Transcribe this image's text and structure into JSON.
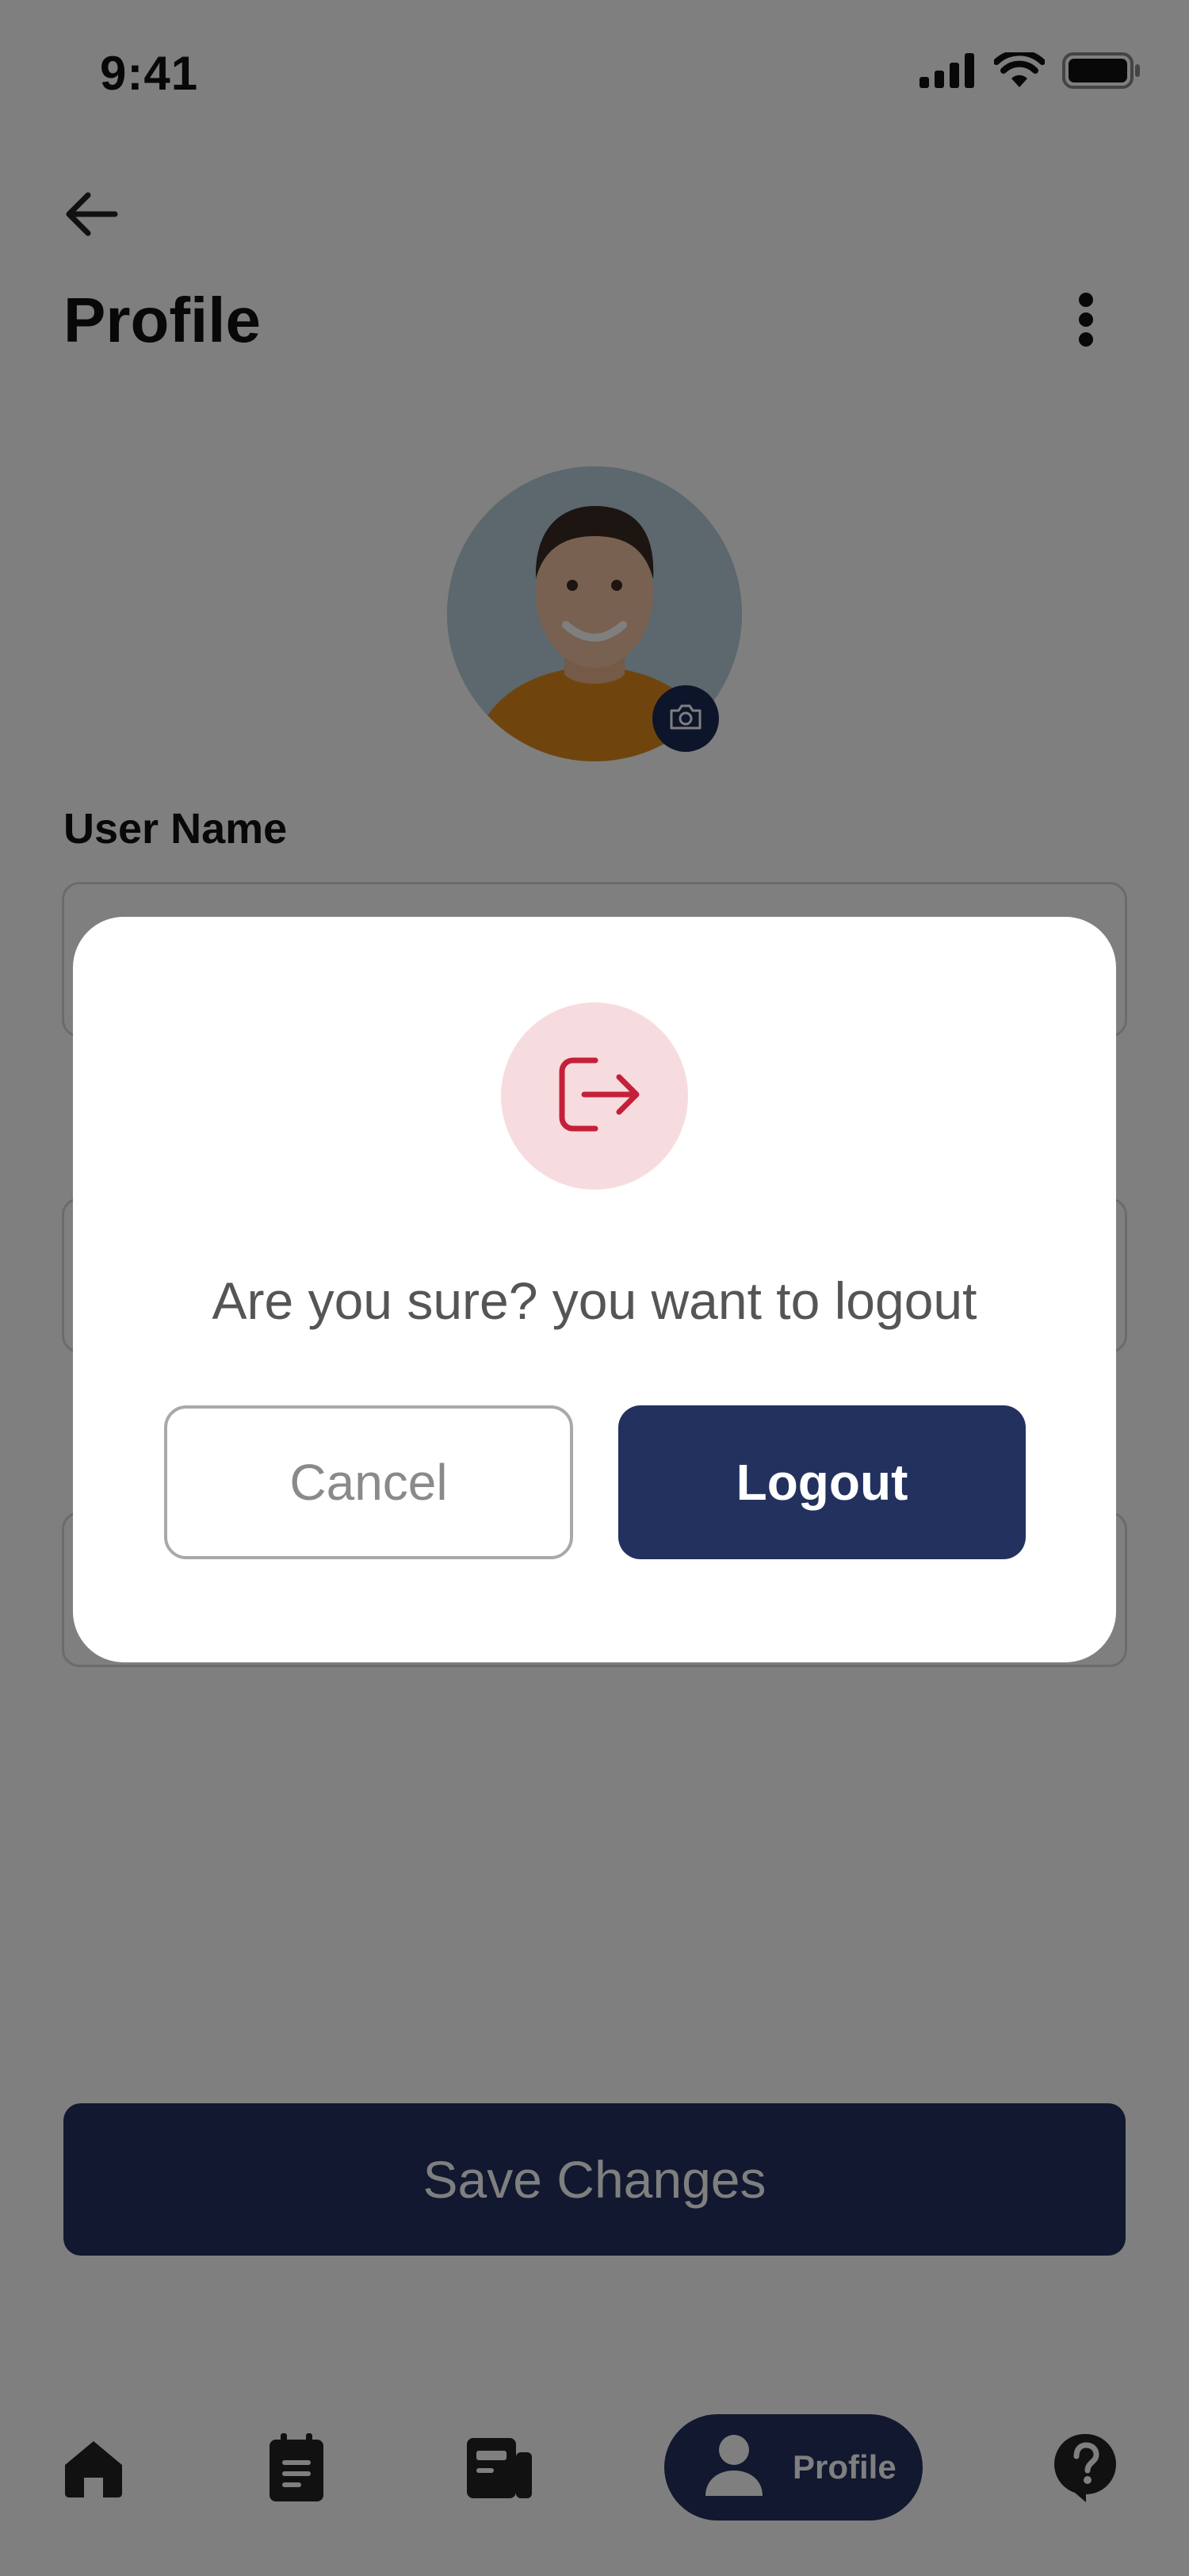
{
  "status_bar": {
    "time": "9:41"
  },
  "header": {
    "title": "Profile"
  },
  "form": {
    "fields": [
      {
        "label": "User Name",
        "value": ""
      }
    ]
  },
  "save_button": {
    "label": "Save Changes"
  },
  "bottom_nav": {
    "items": [
      {
        "icon": "home-icon"
      },
      {
        "icon": "clipboard-icon"
      },
      {
        "icon": "newspaper-icon"
      },
      {
        "icon": "person-icon",
        "label": "Profile",
        "active": true
      },
      {
        "icon": "help-icon"
      }
    ]
  },
  "logout_dialog": {
    "icon": "logout-icon",
    "message": "Are you sure? you want to logout",
    "cancel_label": "Cancel",
    "confirm_label": "Logout"
  },
  "colors": {
    "primary": "#22315e",
    "danger": "#c4203a",
    "danger_soft": "#f7dcdf",
    "overlay": "rgba(0,0,0,0.5)"
  }
}
